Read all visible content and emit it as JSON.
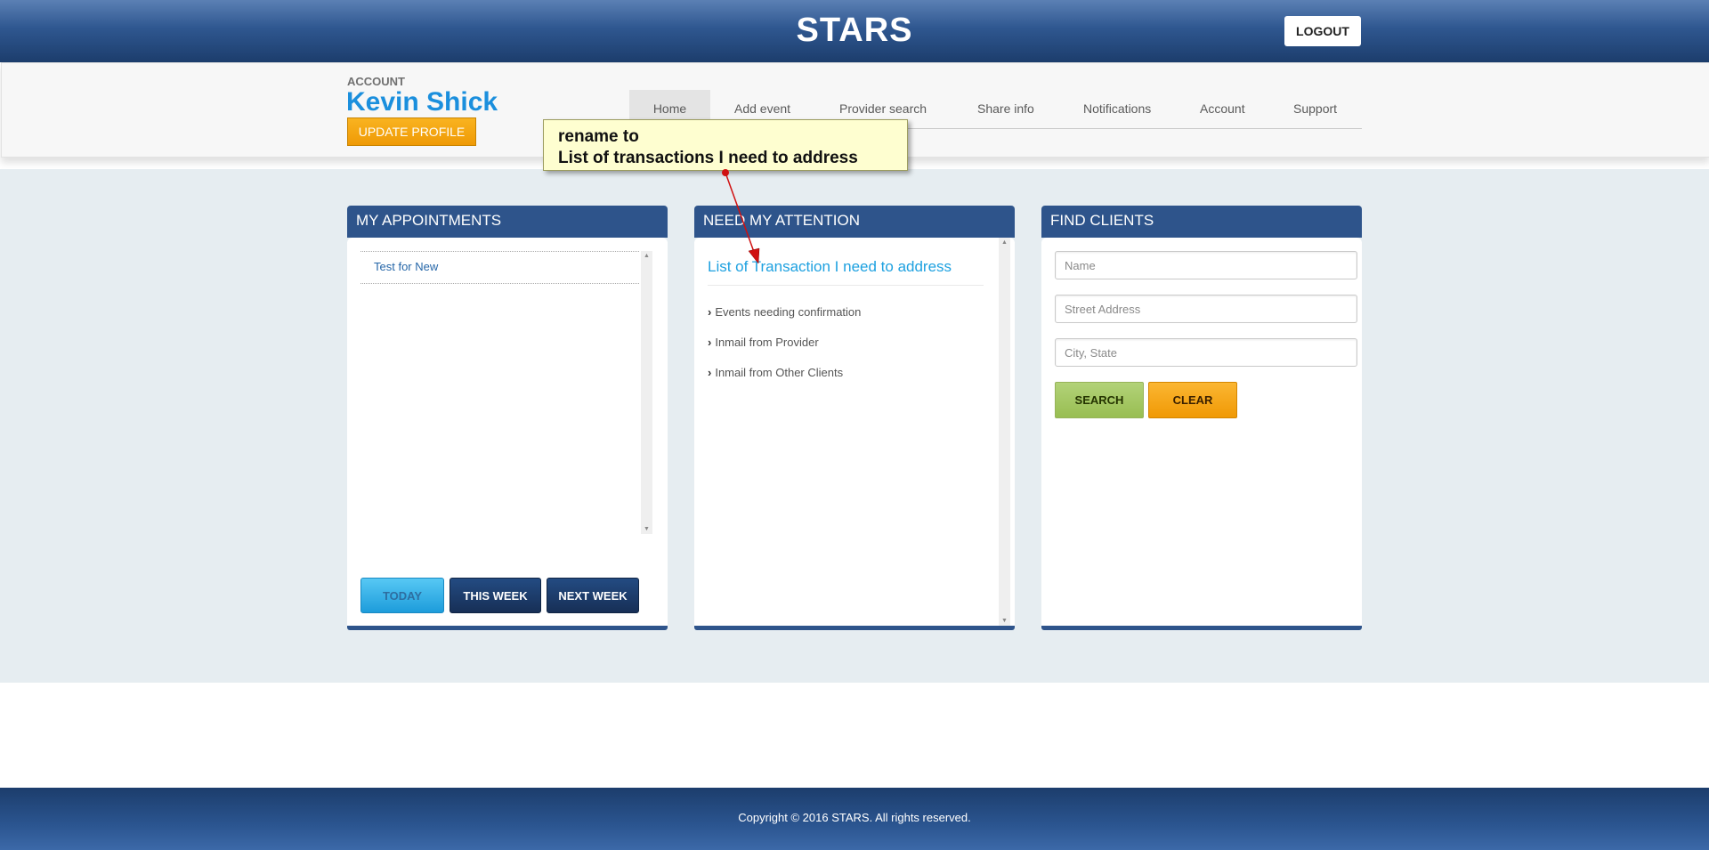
{
  "header": {
    "brand": "STARS",
    "logout_label": "LOGOUT"
  },
  "account": {
    "label": "ACCOUNT",
    "name": "Kevin Shick",
    "update_label": "UPDATE PROFILE"
  },
  "nav": {
    "items": [
      {
        "label": "Home",
        "active": true
      },
      {
        "label": "Add event"
      },
      {
        "label": "Provider search"
      },
      {
        "label": "Share info"
      },
      {
        "label": "Notifications"
      },
      {
        "label": "Account"
      },
      {
        "label": "Support"
      }
    ]
  },
  "appointments": {
    "title": "MY APPOINTMENTS",
    "items": [
      "Test for New"
    ],
    "buttons": {
      "today": "TODAY",
      "this_week": "THIS WEEK",
      "next_week": "NEXT WEEK"
    }
  },
  "attention": {
    "title": "NEED MY ATTENTION",
    "heading": "List of Transaction I need to address",
    "links": [
      "Events needing confirmation",
      "Inmail from Provider",
      "Inmail from Other Clients"
    ]
  },
  "find_clients": {
    "title": "FIND CLIENTS",
    "name_placeholder": "Name",
    "street_placeholder": "Street Address",
    "city_placeholder": "City, State",
    "search_label": "SEARCH",
    "clear_label": "CLEAR"
  },
  "annotation": {
    "line1": "rename to",
    "line2": "List of transactions I need to address"
  },
  "footer": {
    "copyright": "Copyright © 2016 STARS. All rights reserved."
  },
  "colors": {
    "header_blue": "#2f5790",
    "panel_blue": "#2e548b",
    "accent_link": "#1ea1e0",
    "orange": "#f0a010",
    "green": "#a4c863",
    "callout_bg": "#fefed0",
    "callout_arrow": "#d01010"
  }
}
